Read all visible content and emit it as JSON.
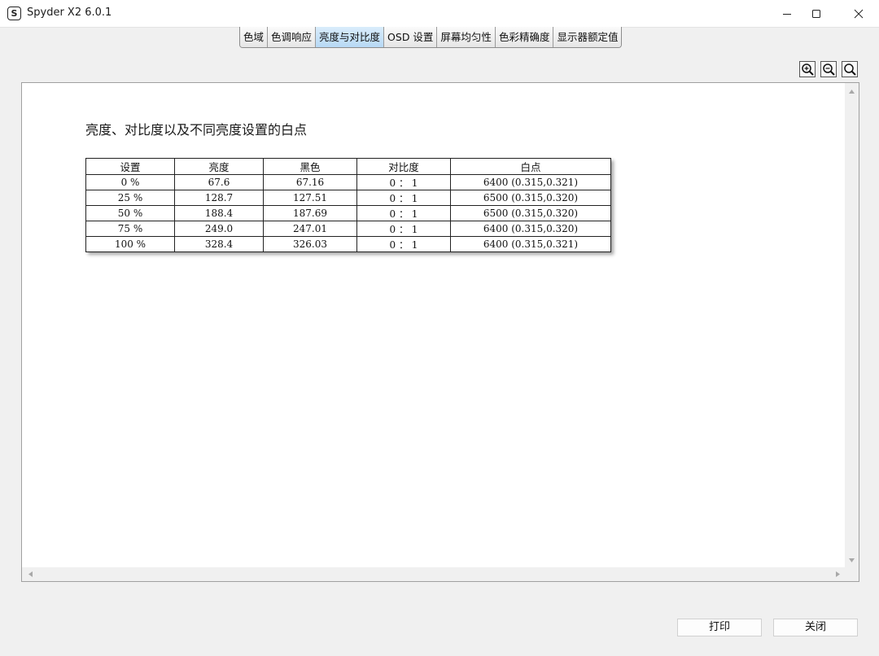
{
  "window": {
    "title": "Spyder X2 6.0.1",
    "app_icon_letter": "S"
  },
  "tabs": [
    {
      "label": "色域"
    },
    {
      "label": "色调响应"
    },
    {
      "label": "亮度与对比度"
    },
    {
      "label": "OSD 设置"
    },
    {
      "label": "屏幕均匀性"
    },
    {
      "label": "色彩精确度"
    },
    {
      "label": "显示器额定值"
    }
  ],
  "active_tab": "亮度与对比度",
  "report": {
    "title": "亮度、对比度以及不同亮度设置的白点",
    "columns": [
      "设置",
      "亮度",
      "黑色",
      "对比度",
      "白点"
    ],
    "rows": [
      [
        "0 %",
        "67.6",
        "67.16",
        "0 ： 1",
        "6400 (0.315,0.321)"
      ],
      [
        "25 %",
        "128.7",
        "127.51",
        "0 ： 1",
        "6500 (0.315,0.320)"
      ],
      [
        "50 %",
        "188.4",
        "187.69",
        "0 ： 1",
        "6500 (0.315,0.320)"
      ],
      [
        "75 %",
        "249.0",
        "247.01",
        "0 ： 1",
        "6400 (0.315,0.320)"
      ],
      [
        "100 %",
        "328.4",
        "326.03",
        "0 ： 1",
        "6400 (0.315,0.321)"
      ]
    ]
  },
  "buttons": {
    "print": "打印",
    "close": "关闭"
  },
  "colors": {
    "active_tab": "#b7d9f5",
    "background": "#f0f0f0",
    "panel": "#ffffff"
  },
  "icons": [
    "zoom-in-icon",
    "zoom-out-icon",
    "zoom-fit-icon",
    "minimize-icon",
    "maximize-icon",
    "close-icon"
  ]
}
